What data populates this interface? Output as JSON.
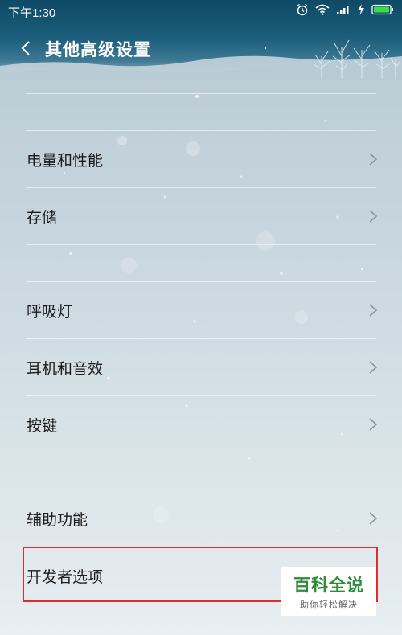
{
  "status_bar": {
    "time": "下午1:30",
    "icons": [
      "alarm-icon",
      "wifi-icon",
      "signal-icon",
      "charging-icon",
      "battery-icon"
    ]
  },
  "header": {
    "title": "其他高级设置",
    "back_icon": "chevron-left-icon"
  },
  "settings": {
    "items": [
      {
        "label": "电量和性能",
        "icon": "chevron-right-icon"
      },
      {
        "label": "存储",
        "icon": "chevron-right-icon"
      },
      {
        "label": "呼吸灯",
        "icon": "chevron-right-icon"
      },
      {
        "label": "耳机和音效",
        "icon": "chevron-right-icon"
      },
      {
        "label": "按键",
        "icon": "chevron-right-icon"
      },
      {
        "label": "辅助功能",
        "icon": "chevron-right-icon"
      },
      {
        "label": "开发者选项",
        "icon": "chevron-right-icon"
      }
    ]
  },
  "watermark": {
    "logo": "百科全说",
    "tagline": "助你轻松解决"
  },
  "colors": {
    "highlight": "#e02b2b",
    "header_top": "#0f4a66",
    "watermark_green": "#2e8b3a"
  }
}
